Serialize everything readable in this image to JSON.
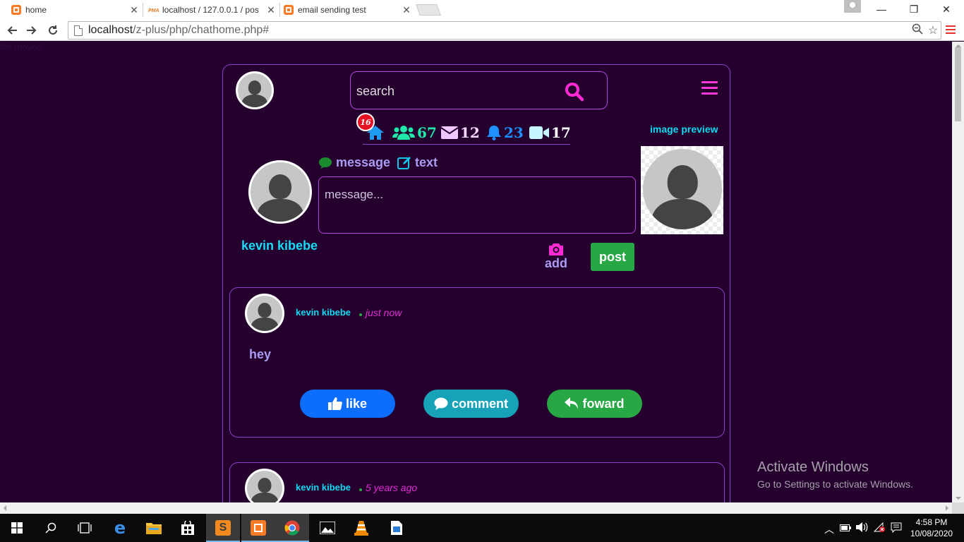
{
  "browser": {
    "tabs": [
      {
        "label": "home",
        "icon": "xampp-icon",
        "active": true
      },
      {
        "label": "localhost / 127.0.0.1 / pos",
        "icon": "phpmyadmin-icon",
        "active": false
      },
      {
        "label": "email sending test",
        "icon": "xampp-icon",
        "active": false
      }
    ],
    "pma_logo_text": "PMA",
    "url_host": "localhost",
    "url_path": "/z-plus/php/chathome.php#"
  },
  "page": {
    "ghost_text": "file moved",
    "search": {
      "placeholder": "search"
    },
    "stats": {
      "home_badge": "16",
      "friends": "67",
      "messages": "12",
      "notifications": "23",
      "videos": "17"
    },
    "image_preview_label": "image preview",
    "composer": {
      "message_tab": "message",
      "text_tab": "text",
      "placeholder": "message...",
      "user_name": "kevin kibebe",
      "add_label": "add",
      "post_label": "post"
    },
    "posts": [
      {
        "author": "kevin kibebe",
        "time": "just now",
        "text": "hey",
        "like": "like",
        "comment": "comment",
        "forward": "foward"
      },
      {
        "author": "kevin kibebe",
        "time": "5 years ago"
      }
    ],
    "colors": {
      "background": "#25002e",
      "border": "#8c3fc7",
      "accent_pink": "#ff3ad9",
      "cyan": "#12d8f0",
      "like_blue": "#0d6efd",
      "comment_teal": "#17a2b8",
      "forward_green": "#28a745"
    }
  },
  "windows": {
    "activate_title": "Activate Windows",
    "activate_sub": "Go to Settings to activate Windows.",
    "time": "4:58 PM",
    "date": "10/08/2020"
  }
}
